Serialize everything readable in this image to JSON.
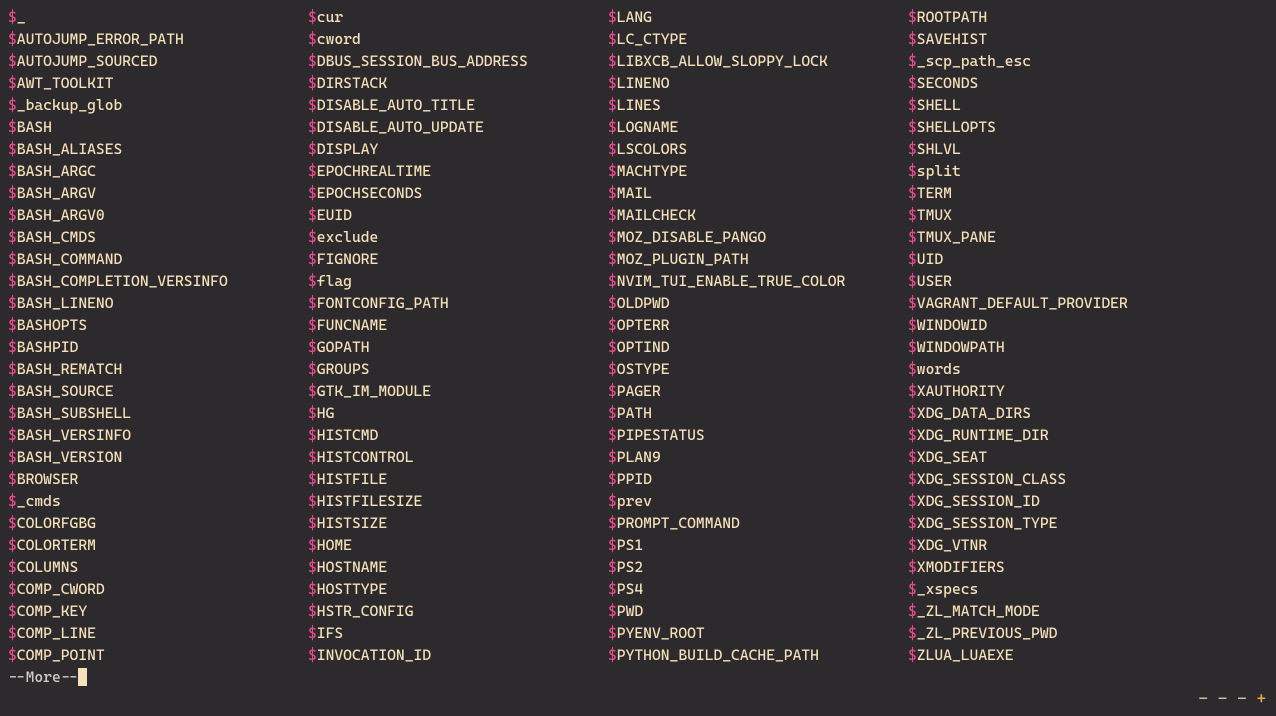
{
  "prompt_symbol": "$",
  "more_text": "--More--",
  "statusbar": {
    "item1": "-",
    "item2": "-",
    "item3": "-",
    "item4": "+"
  },
  "columns": [
    [
      "_",
      "AUTOJUMP_ERROR_PATH",
      "AUTOJUMP_SOURCED",
      "AWT_TOOLKIT",
      "_backup_glob",
      "BASH",
      "BASH_ALIASES",
      "BASH_ARGC",
      "BASH_ARGV",
      "BASH_ARGV0",
      "BASH_CMDS",
      "BASH_COMMAND",
      "BASH_COMPLETION_VERSINFO",
      "BASH_LINENO",
      "BASHOPTS",
      "BASHPID",
      "BASH_REMATCH",
      "BASH_SOURCE",
      "BASH_SUBSHELL",
      "BASH_VERSINFO",
      "BASH_VERSION",
      "BROWSER",
      "_cmds",
      "COLORFGBG",
      "COLORTERM",
      "COLUMNS",
      "COMP_CWORD",
      "COMP_KEY",
      "COMP_LINE",
      "COMP_POINT"
    ],
    [
      "cur",
      "cword",
      "DBUS_SESSION_BUS_ADDRESS",
      "DIRSTACK",
      "DISABLE_AUTO_TITLE",
      "DISABLE_AUTO_UPDATE",
      "DISPLAY",
      "EPOCHREALTIME",
      "EPOCHSECONDS",
      "EUID",
      "exclude",
      "FIGNORE",
      "flag",
      "FONTCONFIG_PATH",
      "FUNCNAME",
      "GOPATH",
      "GROUPS",
      "GTK_IM_MODULE",
      "HG",
      "HISTCMD",
      "HISTCONTROL",
      "HISTFILE",
      "HISTFILESIZE",
      "HISTSIZE",
      "HOME",
      "HOSTNAME",
      "HOSTTYPE",
      "HSTR_CONFIG",
      "IFS",
      "INVOCATION_ID"
    ],
    [
      "LANG",
      "LC_CTYPE",
      "LIBXCB_ALLOW_SLOPPY_LOCK",
      "LINENO",
      "LINES",
      "LOGNAME",
      "LSCOLORS",
      "MACHTYPE",
      "MAIL",
      "MAILCHECK",
      "MOZ_DISABLE_PANGO",
      "MOZ_PLUGIN_PATH",
      "NVIM_TUI_ENABLE_TRUE_COLOR",
      "OLDPWD",
      "OPTERR",
      "OPTIND",
      "OSTYPE",
      "PAGER",
      "PATH",
      "PIPESTATUS",
      "PLAN9",
      "PPID",
      "prev",
      "PROMPT_COMMAND",
      "PS1",
      "PS2",
      "PS4",
      "PWD",
      "PYENV_ROOT",
      "PYTHON_BUILD_CACHE_PATH"
    ],
    [
      "ROOTPATH",
      "SAVEHIST",
      "_scp_path_esc",
      "SECONDS",
      "SHELL",
      "SHELLOPTS",
      "SHLVL",
      "split",
      "TERM",
      "TMUX",
      "TMUX_PANE",
      "UID",
      "USER",
      "VAGRANT_DEFAULT_PROVIDER",
      "WINDOWID",
      "WINDOWPATH",
      "words",
      "XAUTHORITY",
      "XDG_DATA_DIRS",
      "XDG_RUNTIME_DIR",
      "XDG_SEAT",
      "XDG_SESSION_CLASS",
      "XDG_SESSION_ID",
      "XDG_SESSION_TYPE",
      "XDG_VTNR",
      "XMODIFIERS",
      "_xspecs",
      "_ZL_MATCH_MODE",
      "_ZL_PREVIOUS_PWD",
      "ZLUA_LUAEXE"
    ]
  ]
}
